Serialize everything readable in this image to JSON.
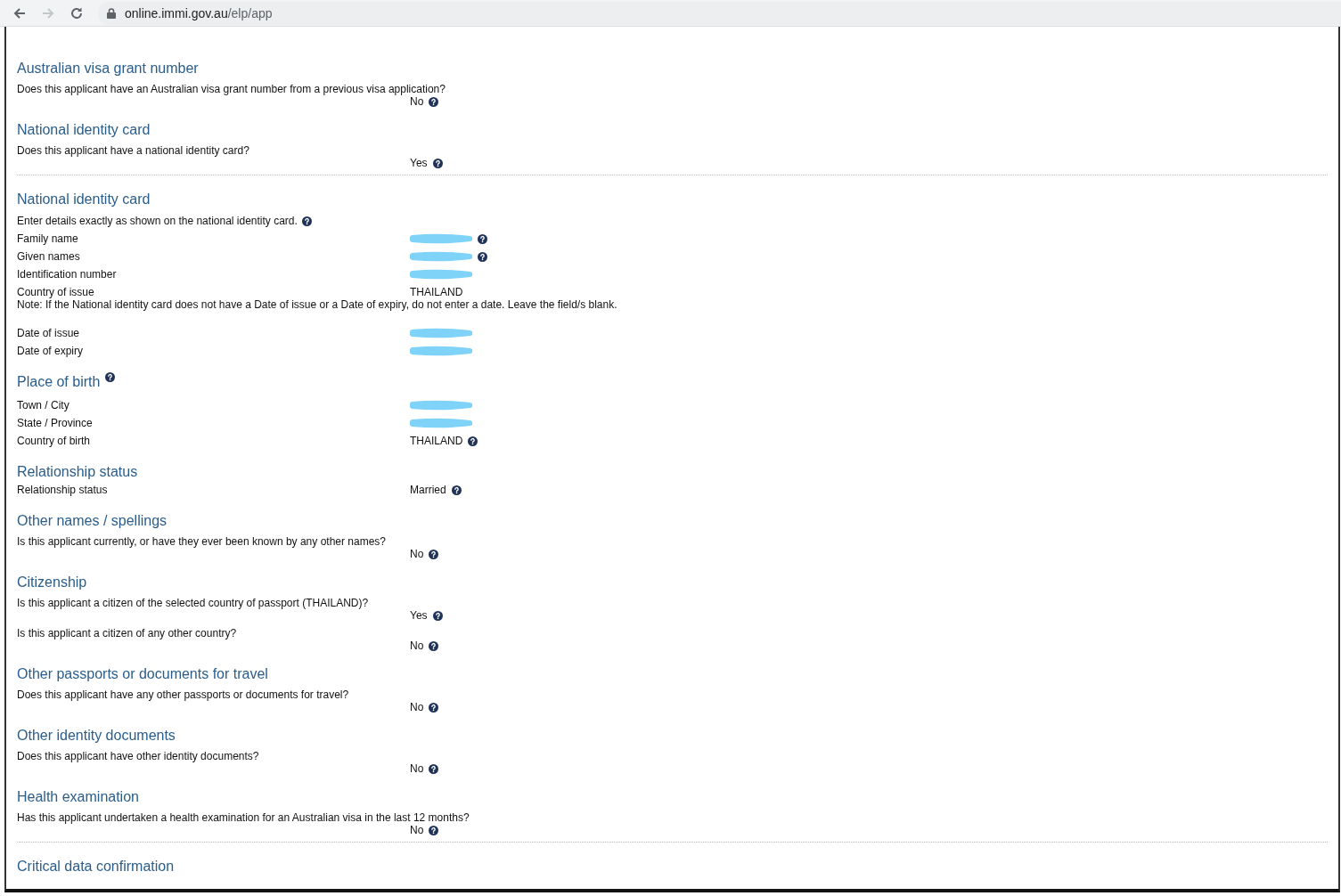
{
  "browser": {
    "url_host": "online.immi.gov.au",
    "url_path": "/elp/app",
    "forward_disabled": true
  },
  "sections": [
    {
      "title": "Australian visa grant number",
      "title_help": false,
      "divider_after": false,
      "items": [
        {
          "kind": "question",
          "text": "Does this applicant have an Australian visa grant number from a previous visa application?",
          "answer": "No",
          "help": true
        }
      ]
    },
    {
      "title": "National identity card",
      "title_help": false,
      "divider_after": true,
      "items": [
        {
          "kind": "question",
          "text": "Does this applicant have a national identity card?",
          "answer": "Yes",
          "help": true
        }
      ]
    },
    {
      "title": "National identity card",
      "title_help": false,
      "divider_after": false,
      "items": [
        {
          "kind": "intro",
          "text": "Enter details exactly as shown on the national identity card.",
          "help": true
        },
        {
          "kind": "field",
          "label": "Family name",
          "redacted": true,
          "help": true
        },
        {
          "kind": "field",
          "label": "Given names",
          "redacted": true,
          "help": true
        },
        {
          "kind": "field",
          "label": "Identification number",
          "redacted": true,
          "help": false
        },
        {
          "kind": "field",
          "label": "Country of issue",
          "value": "THAILAND",
          "help": false
        },
        {
          "kind": "note",
          "text": "Note: If the National identity card does not have a Date of issue or a Date of expiry, do not enter a date. Leave the field/s blank."
        },
        {
          "kind": "field",
          "label": "Date of issue",
          "redacted": true,
          "help": false
        },
        {
          "kind": "field",
          "label": "Date of expiry",
          "redacted": true,
          "help": false
        }
      ]
    },
    {
      "title": "Place of birth",
      "title_help": true,
      "divider_after": false,
      "items": [
        {
          "kind": "field",
          "label": "Town / City",
          "redacted": true,
          "help": false
        },
        {
          "kind": "field",
          "label": "State / Province",
          "redacted": true,
          "help": false
        },
        {
          "kind": "field",
          "label": "Country of birth",
          "value": "THAILAND",
          "help": true
        }
      ]
    },
    {
      "title": "Relationship status",
      "title_help": false,
      "divider_after": false,
      "items": [
        {
          "kind": "field",
          "label": "Relationship status",
          "value": "Married",
          "help": true
        }
      ]
    },
    {
      "title": "Other names / spellings",
      "title_help": false,
      "divider_after": false,
      "items": [
        {
          "kind": "question",
          "text": "Is this applicant currently, or have they ever been known by any other names?",
          "answer": "No",
          "help": true
        }
      ]
    },
    {
      "title": "Citizenship",
      "title_help": false,
      "divider_after": false,
      "items": [
        {
          "kind": "question",
          "text": "Is this applicant a citizen of the selected country of passport (THAILAND)?",
          "answer": "Yes",
          "help": true
        },
        {
          "kind": "question",
          "text": "Is this applicant a citizen of any other country?",
          "answer": "No",
          "help": true
        }
      ]
    },
    {
      "title": "Other passports or documents for travel",
      "title_help": false,
      "divider_after": false,
      "items": [
        {
          "kind": "question",
          "text": "Does this applicant have any other passports or documents for travel?",
          "answer": "No",
          "help": true
        }
      ]
    },
    {
      "title": "Other identity documents",
      "title_help": false,
      "divider_after": false,
      "items": [
        {
          "kind": "question",
          "text": "Does this applicant have other identity documents?",
          "answer": "No",
          "help": true
        }
      ]
    },
    {
      "title": "Health examination",
      "title_help": false,
      "divider_after": true,
      "items": [
        {
          "kind": "question",
          "text": "Has this applicant undertaken a health examination for an Australian visa in the last 12 months?",
          "answer": "No",
          "help": true
        }
      ]
    },
    {
      "title": "Critical data confirmation",
      "title_help": false,
      "divider_after": false
    }
  ]
}
